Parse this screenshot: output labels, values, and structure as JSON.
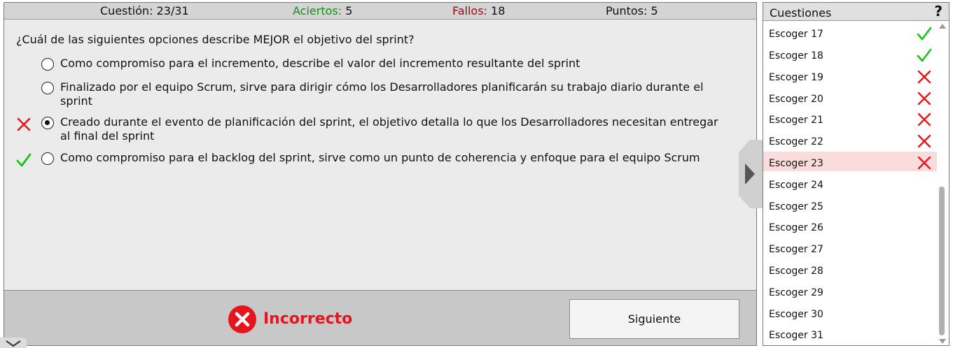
{
  "stats": {
    "question_label": "Cuestión:",
    "question_value": "23/31",
    "correct_label": "Aciertos:",
    "correct_value": "5",
    "wrong_label": "Fallos:",
    "wrong_value": "18",
    "points_label": "Puntos:",
    "points_value": "5",
    "colors": {
      "correct": "#1a8a1a",
      "wrong": "#8b1111"
    }
  },
  "question": "¿Cuál de las siguientes opciones describe MEJOR el objetivo del sprint?",
  "options": [
    {
      "text": "Como compromiso para el incremento, describe el valor del incremento resultante del sprint",
      "selected": false,
      "mark": ""
    },
    {
      "text": "Finalizado por el equipo Scrum, sirve para dirigir cómo los Desarrolladores planificarán su trabajo diario durante el sprint",
      "selected": false,
      "mark": ""
    },
    {
      "text": "Creado durante el evento de planificación del sprint, el objetivo detalla lo que los Desarrolladores necesitan entregar al final del sprint",
      "selected": true,
      "mark": "cross-icon"
    },
    {
      "text": "Como compromiso para el backlog del sprint, sirve como un punto de coherencia y enfoque para el equipo Scrum",
      "selected": false,
      "mark": "check-icon"
    }
  ],
  "result": {
    "text": "Incorrecto",
    "icon": "error-circle-icon",
    "color": "#e8141c"
  },
  "next_button": "Siguiente",
  "panel": {
    "title": "Cuestiones",
    "help": "?",
    "items": [
      {
        "label": "Escoger 17",
        "status": "correct"
      },
      {
        "label": "Escoger 18",
        "status": "correct"
      },
      {
        "label": "Escoger 19",
        "status": "wrong"
      },
      {
        "label": "Escoger 20",
        "status": "wrong"
      },
      {
        "label": "Escoger 21",
        "status": "wrong"
      },
      {
        "label": "Escoger 22",
        "status": "wrong"
      },
      {
        "label": "Escoger 23",
        "status": "wrong",
        "current": true
      },
      {
        "label": "Escoger 24",
        "status": ""
      },
      {
        "label": "Escoger 25",
        "status": ""
      },
      {
        "label": "Escoger 26",
        "status": ""
      },
      {
        "label": "Escoger 27",
        "status": ""
      },
      {
        "label": "Escoger 28",
        "status": ""
      },
      {
        "label": "Escoger 29",
        "status": ""
      },
      {
        "label": "Escoger 30",
        "status": ""
      },
      {
        "label": "Escoger 31",
        "status": ""
      }
    ]
  },
  "colors": {
    "check": "#18c418",
    "cross": "#e8141c",
    "current_row": "#fadcdc"
  }
}
